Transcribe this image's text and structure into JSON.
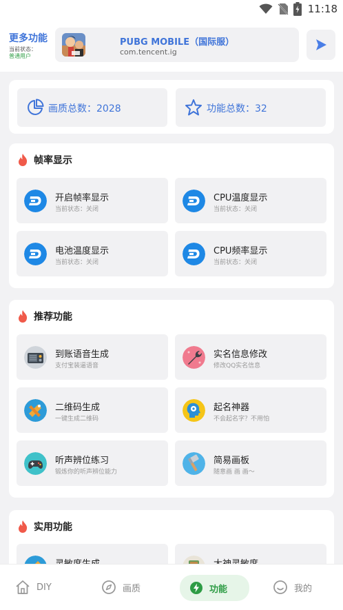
{
  "status_bar": {
    "time": "11:18"
  },
  "header": {
    "title": "更多功能",
    "state_label": "当前状态：",
    "state_value": "普通用户",
    "game": {
      "name": "PUBG MOBILE（国际服）",
      "package": "com.tencent.ig"
    }
  },
  "counts": {
    "quality_label": "画质总数：2028",
    "function_label": "功能总数：32"
  },
  "sections": [
    {
      "title": "帧率显示",
      "items": [
        {
          "title": "开启帧率显示",
          "subtitle": "当前状态：关闭"
        },
        {
          "title": "CPU温度显示",
          "subtitle": "当前状态：关闭"
        },
        {
          "title": "电池温度显示",
          "subtitle": "当前状态：关闭"
        },
        {
          "title": "CPU频率显示",
          "subtitle": "当前状态：关闭"
        }
      ]
    },
    {
      "title": "推荐功能",
      "items": [
        {
          "title": "到账语音生成",
          "subtitle": "支付宝装逼语音"
        },
        {
          "title": "实名信息修改",
          "subtitle": "修改QQ实名信息"
        },
        {
          "title": "二维码生成",
          "subtitle": "一键生成二维码"
        },
        {
          "title": "起名神器",
          "subtitle": "不会起名字？不用怕"
        },
        {
          "title": "听声辨位练习",
          "subtitle": "锻炼你的听声辨位能力"
        },
        {
          "title": "简易画板",
          "subtitle": "随意画 画 画～"
        }
      ]
    },
    {
      "title": "实用功能",
      "items": [
        {
          "title": "灵敏度生成",
          "subtitle": ""
        },
        {
          "title": "大神灵敏度",
          "subtitle": ""
        }
      ]
    }
  ],
  "nav": [
    {
      "label": "DIY",
      "icon": "home-icon"
    },
    {
      "label": "画质",
      "icon": "compass-icon"
    },
    {
      "label": "功能",
      "icon": "bolt-icon"
    },
    {
      "label": "我的",
      "icon": "smile-icon"
    }
  ],
  "colors": {
    "accent_blue": "#3f74d9",
    "active_green": "#2e9c45",
    "flame_red": "#f05a4a",
    "dash_blue": "#1e88e5"
  }
}
